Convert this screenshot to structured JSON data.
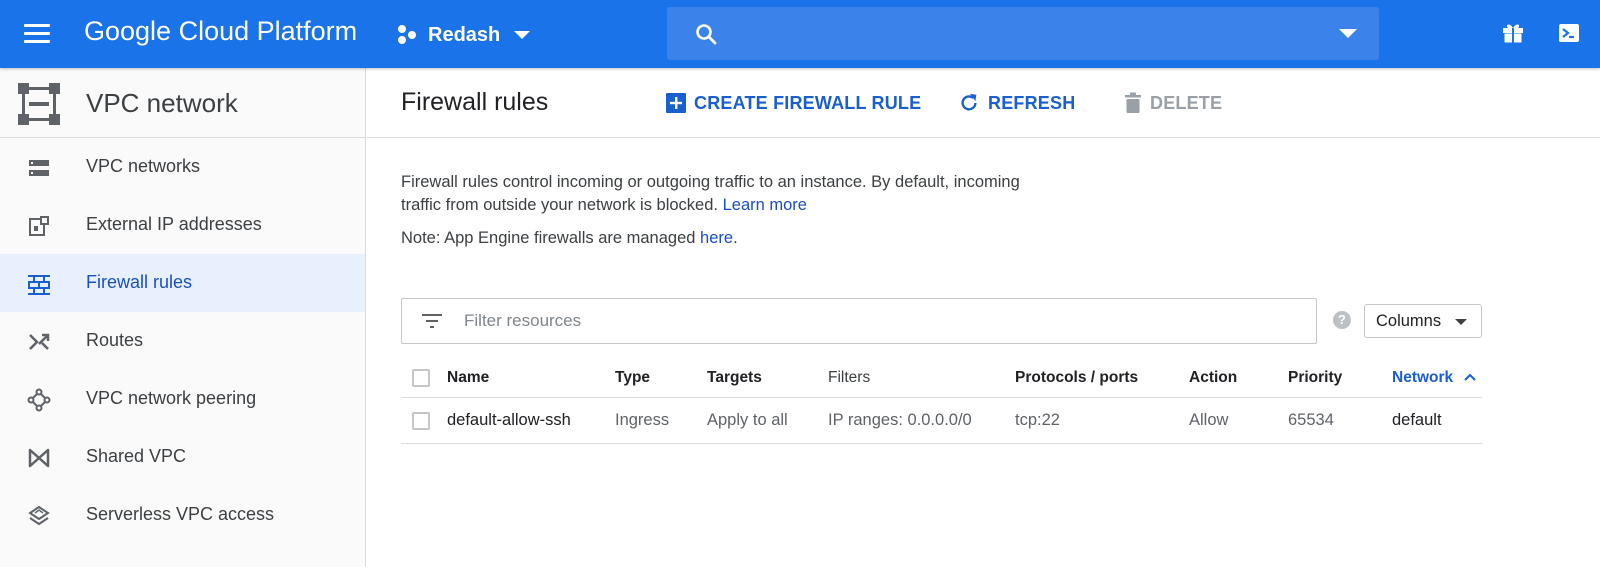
{
  "topbar": {
    "brand": "Google Cloud Platform",
    "project_name": "Redash",
    "search_placeholder": "",
    "accent_color": "#1a73e8"
  },
  "sidebar": {
    "title": "VPC network",
    "items": [
      {
        "label": "VPC networks",
        "icon": "vpc-networks-icon",
        "active": false
      },
      {
        "label": "External IP addresses",
        "icon": "external-ip-icon",
        "active": false
      },
      {
        "label": "Firewall rules",
        "icon": "firewall-icon",
        "active": true
      },
      {
        "label": "Routes",
        "icon": "routes-icon",
        "active": false
      },
      {
        "label": "VPC network peering",
        "icon": "peering-icon",
        "active": false
      },
      {
        "label": "Shared VPC",
        "icon": "shared-vpc-icon",
        "active": false
      },
      {
        "label": "Serverless VPC access",
        "icon": "serverless-icon",
        "active": false
      }
    ]
  },
  "main": {
    "title": "Firewall rules",
    "toolbar": {
      "create_label": "CREATE FIREWALL RULE",
      "refresh_label": "REFRESH",
      "delete_label": "DELETE"
    },
    "description": "Firewall rules control incoming or outgoing traffic to an instance. By default, incoming traffic from outside your network is blocked.",
    "learn_more": "Learn more",
    "note_prefix": "Note: App Engine firewalls are managed",
    "note_link": "here",
    "note_suffix": ".",
    "filter_placeholder": "Filter resources",
    "help_glyph": "?",
    "columns_label": "Columns"
  },
  "table": {
    "headers": [
      "Name",
      "Type",
      "Targets",
      "Filters",
      "Protocols / ports",
      "Action",
      "Priority",
      "Network"
    ],
    "sorted_column": "Network",
    "rows": [
      {
        "name": "default-allow-ssh",
        "type": "Ingress",
        "targets": "Apply to all",
        "filters": "IP ranges: 0.0.0.0/0",
        "protocols": "tcp:22",
        "action": "Allow",
        "priority": "65534",
        "network": "default"
      }
    ]
  }
}
